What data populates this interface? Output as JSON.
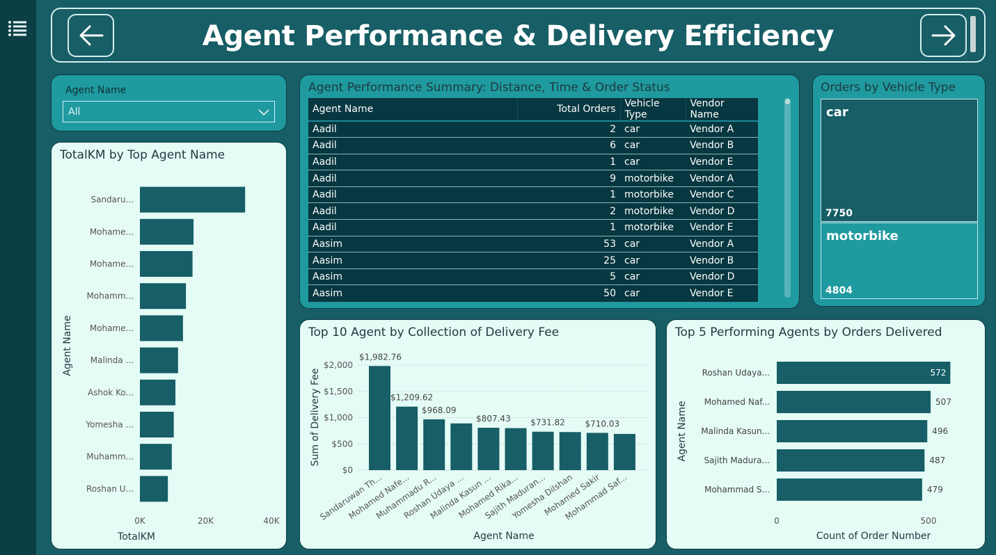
{
  "header": {
    "title": "Agent Performance & Delivery Efficiency"
  },
  "nav": {
    "menu_icon": "hamburger-list-icon",
    "back_icon": "arrow-left-icon",
    "forward_icon": "arrow-right-icon"
  },
  "slicer": {
    "label": "Agent Name",
    "value": "All",
    "icon": "chevron-down-icon"
  },
  "summary_table": {
    "title": "Agent Performance Summary: Distance, Time & Order Status",
    "columns": [
      "Agent Name",
      "Total Orders",
      "Vehicle Type",
      "Vendor Name"
    ],
    "rows": [
      [
        "Aadil",
        "2",
        "car",
        "Vendor A"
      ],
      [
        "Aadil",
        "6",
        "car",
        "Vendor B"
      ],
      [
        "Aadil",
        "1",
        "car",
        "Vendor E"
      ],
      [
        "Aadil",
        "9",
        "motorbike",
        "Vendor A"
      ],
      [
        "Aadil",
        "1",
        "motorbike",
        "Vendor C"
      ],
      [
        "Aadil",
        "2",
        "motorbike",
        "Vendor D"
      ],
      [
        "Aadil",
        "1",
        "motorbike",
        "Vendor E"
      ],
      [
        "Aasim",
        "53",
        "car",
        "Vendor A"
      ],
      [
        "Aasim",
        "25",
        "car",
        "Vendor B"
      ],
      [
        "Aasim",
        "5",
        "car",
        "Vendor D"
      ],
      [
        "Aasim",
        "50",
        "car",
        "Vendor E"
      ]
    ]
  },
  "vehicle_treemap": {
    "title": "Orders by Vehicle Type",
    "items": [
      {
        "label": "car",
        "value": "7750"
      },
      {
        "label": "motorbike",
        "value": "4804"
      }
    ]
  },
  "colors": {
    "bar": "#175e66",
    "card_teal": "#1f9a9f",
    "card_mint": "#e5fbf6",
    "table_bg": "#073740",
    "tile_car": "#175e66",
    "tile_motorbike": "#1f9a9f"
  },
  "chart_data": [
    {
      "type": "bar",
      "orientation": "horizontal",
      "title": "TotalKM by Top Agent Name",
      "xlabel": "TotalKM",
      "ylabel": "Agent Name",
      "categories": [
        "Sandaru...",
        "Mohame...",
        "Mohame...",
        "Mohamm...",
        "Mohame...",
        "Malinda ...",
        "Ashok Ko...",
        "Yomesha ...",
        "Muhamm...",
        "Roshan U..."
      ],
      "values": [
        32000,
        16300,
        16000,
        14000,
        13100,
        11600,
        10800,
        10300,
        9700,
        8500
      ],
      "xlim": [
        0,
        40000
      ],
      "xticks": [
        "0K",
        "20K",
        "40K"
      ]
    },
    {
      "type": "bar",
      "title": "Top 10 Agent by Collection of Delivery Fee",
      "xlabel": "Agent Name",
      "ylabel": "Sum of Delivery Fee",
      "categories": [
        "Sandaruwan Th...",
        "Mohamed Nafe...",
        "Muhammadu R...",
        "Roshan Udaya ...",
        "Malinda Kasun ...",
        "Mohamed Rika...",
        "Sajith Maduran...",
        "Yomesha Dilshan",
        "Mohamed Sakir",
        "Mohammad Saf..."
      ],
      "values": [
        1982.76,
        1209.62,
        968.09,
        890,
        807.43,
        800,
        731.82,
        725,
        710.03,
        690
      ],
      "data_labels": [
        "$1,982.76",
        "$1,209.62",
        "$968.09",
        "",
        "$807.43",
        "",
        "$731.82",
        "",
        "$710.03",
        ""
      ],
      "ylim": [
        0,
        2000
      ],
      "yticks": [
        "$0",
        "$500",
        "$1,000",
        "$1,500",
        "$2,000"
      ],
      "grid": true
    },
    {
      "type": "bar",
      "orientation": "horizontal",
      "title": "Top 5 Performing Agents by Orders Delivered",
      "xlabel": "Count of Order Number",
      "ylabel": "Agent Name",
      "categories": [
        "Roshan Udaya...",
        "Mohamed Naf...",
        "Malinda Kasun...",
        "Sajith Madura...",
        "Mohammad S..."
      ],
      "values": [
        572,
        507,
        496,
        487,
        479
      ],
      "data_labels": [
        "572",
        "507",
        "496",
        "487",
        "479"
      ],
      "xlim": [
        0,
        500
      ],
      "xticks": [
        "0",
        "500"
      ]
    }
  ]
}
